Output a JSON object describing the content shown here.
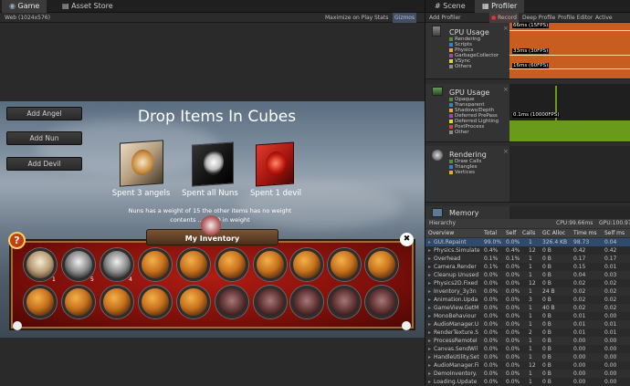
{
  "tabs": {
    "game": "Game",
    "asset_store": "Asset Store",
    "scene": "Scene",
    "profiler": "Profiler"
  },
  "game_toolbar": {
    "resolution": "Web (1024x576)",
    "maximize": "Maximize on Play",
    "stats": "Stats",
    "gizmos": "Gizmos"
  },
  "profiler_toolbar": {
    "add_profiler": "Add Profiler",
    "record": "Record",
    "deep_profile": "Deep Profile",
    "profile_editor": "Profile Editor",
    "active_profiler": "Active Profile"
  },
  "game": {
    "buttons": [
      "Add Angel",
      "Add Nun",
      "Add Devil"
    ],
    "title": "Drop Items In Cubes",
    "cube_captions": [
      "Spent 3 angels",
      "Spent all Nuns",
      "Spent 1 devil"
    ],
    "hint_line1": "Nuns has a weight of 15 the other items has no weight",
    "hint_line2": "contents ... to 50 in weight",
    "inventory_title": "My Inventory",
    "help_icon": "?",
    "close_icon": "✖",
    "slot_counts": [
      "1",
      "5",
      "4"
    ]
  },
  "cpu": {
    "title": "CPU Usage",
    "legend": [
      "Rendering",
      "Scripts",
      "Physics",
      "GarbageCollector",
      "VSync",
      "Others"
    ],
    "colors": [
      "#4f8f3f",
      "#3b7fc4",
      "#e6a83b",
      "#9b4e9b",
      "#d9d73d",
      "#8a8a8a"
    ],
    "markers": [
      "66ms (15FPS)",
      "33ms (30FPS)",
      "16ms (60FPS)"
    ]
  },
  "gpu": {
    "title": "GPU Usage",
    "legend": [
      "Opaque",
      "Transparent",
      "Shadows/Depth",
      "Deferred PrePass",
      "Deferred Lighting",
      "PostProcess",
      "Other"
    ],
    "marker": "0.1ms (10000FPS)"
  },
  "rendering": {
    "title": "Rendering",
    "legend": [
      "Draw Calls",
      "Triangles",
      "Vertices"
    ]
  },
  "memory": {
    "title": "Memory"
  },
  "hierarchy": {
    "label": "Hierarchy",
    "cpu_info": "CPU:99.66ms",
    "gpu_info": "GPU:100.97",
    "columns": [
      "Overview",
      "Total",
      "Self",
      "Calls",
      "GC Alloc",
      "Time ms",
      "Self ms"
    ],
    "rows": [
      [
        "GUI.Repaint",
        "99.0%",
        "0.0%",
        "1",
        "326.4 KB",
        "98.73",
        "0.04"
      ],
      [
        "Physics.Simulate",
        "0.4%",
        "0.4%",
        "12",
        "0 B",
        "0.42",
        "0.42"
      ],
      [
        "Overhead",
        "0.1%",
        "0.1%",
        "1",
        "0 B",
        "0.17",
        "0.17"
      ],
      [
        "Camera.Render",
        "0.1%",
        "0.0%",
        "1",
        "0 B",
        "0.15",
        "0.01"
      ],
      [
        "Cleanup Unused",
        "0.0%",
        "0.0%",
        "1",
        "0 B",
        "0.04",
        "0.03"
      ],
      [
        "Physics2D.Fixed",
        "0.0%",
        "0.0%",
        "12",
        "0 B",
        "0.02",
        "0.02"
      ],
      [
        "Inventory_3y3n",
        "0.0%",
        "0.0%",
        "1",
        "24 B",
        "0.02",
        "0.02"
      ],
      [
        "Animation.Upda",
        "0.0%",
        "0.0%",
        "3",
        "0 B",
        "0.02",
        "0.02"
      ],
      [
        "GameView.GetM",
        "0.0%",
        "0.0%",
        "1",
        "40 B",
        "0.02",
        "0.02"
      ],
      [
        "MonoBehaviour",
        "0.0%",
        "0.0%",
        "1",
        "0 B",
        "0.01",
        "0.00"
      ],
      [
        "AudioManager.U",
        "0.0%",
        "0.0%",
        "1",
        "0 B",
        "0.01",
        "0.01"
      ],
      [
        "RenderTexture.S",
        "0.0%",
        "0.0%",
        "2",
        "0 B",
        "0.01",
        "0.01"
      ],
      [
        "ProcessRemoteI",
        "0.0%",
        "0.0%",
        "1",
        "0 B",
        "0.00",
        "0.00"
      ],
      [
        "Canvas.SendWil",
        "0.0%",
        "0.0%",
        "1",
        "0 B",
        "0.00",
        "0.00"
      ],
      [
        "HandleUtility.Set",
        "0.0%",
        "0.0%",
        "1",
        "0 B",
        "0.00",
        "0.00"
      ],
      [
        "AudioManager.Fi",
        "0.0%",
        "0.0%",
        "12",
        "0 B",
        "0.00",
        "0.00"
      ],
      [
        "DemoInventory.",
        "0.0%",
        "0.0%",
        "1",
        "0 B",
        "0.00",
        "0.00"
      ],
      [
        "Loading.Update",
        "0.0%",
        "0.0%",
        "1",
        "0 B",
        "0.00",
        "0.00"
      ]
    ]
  }
}
